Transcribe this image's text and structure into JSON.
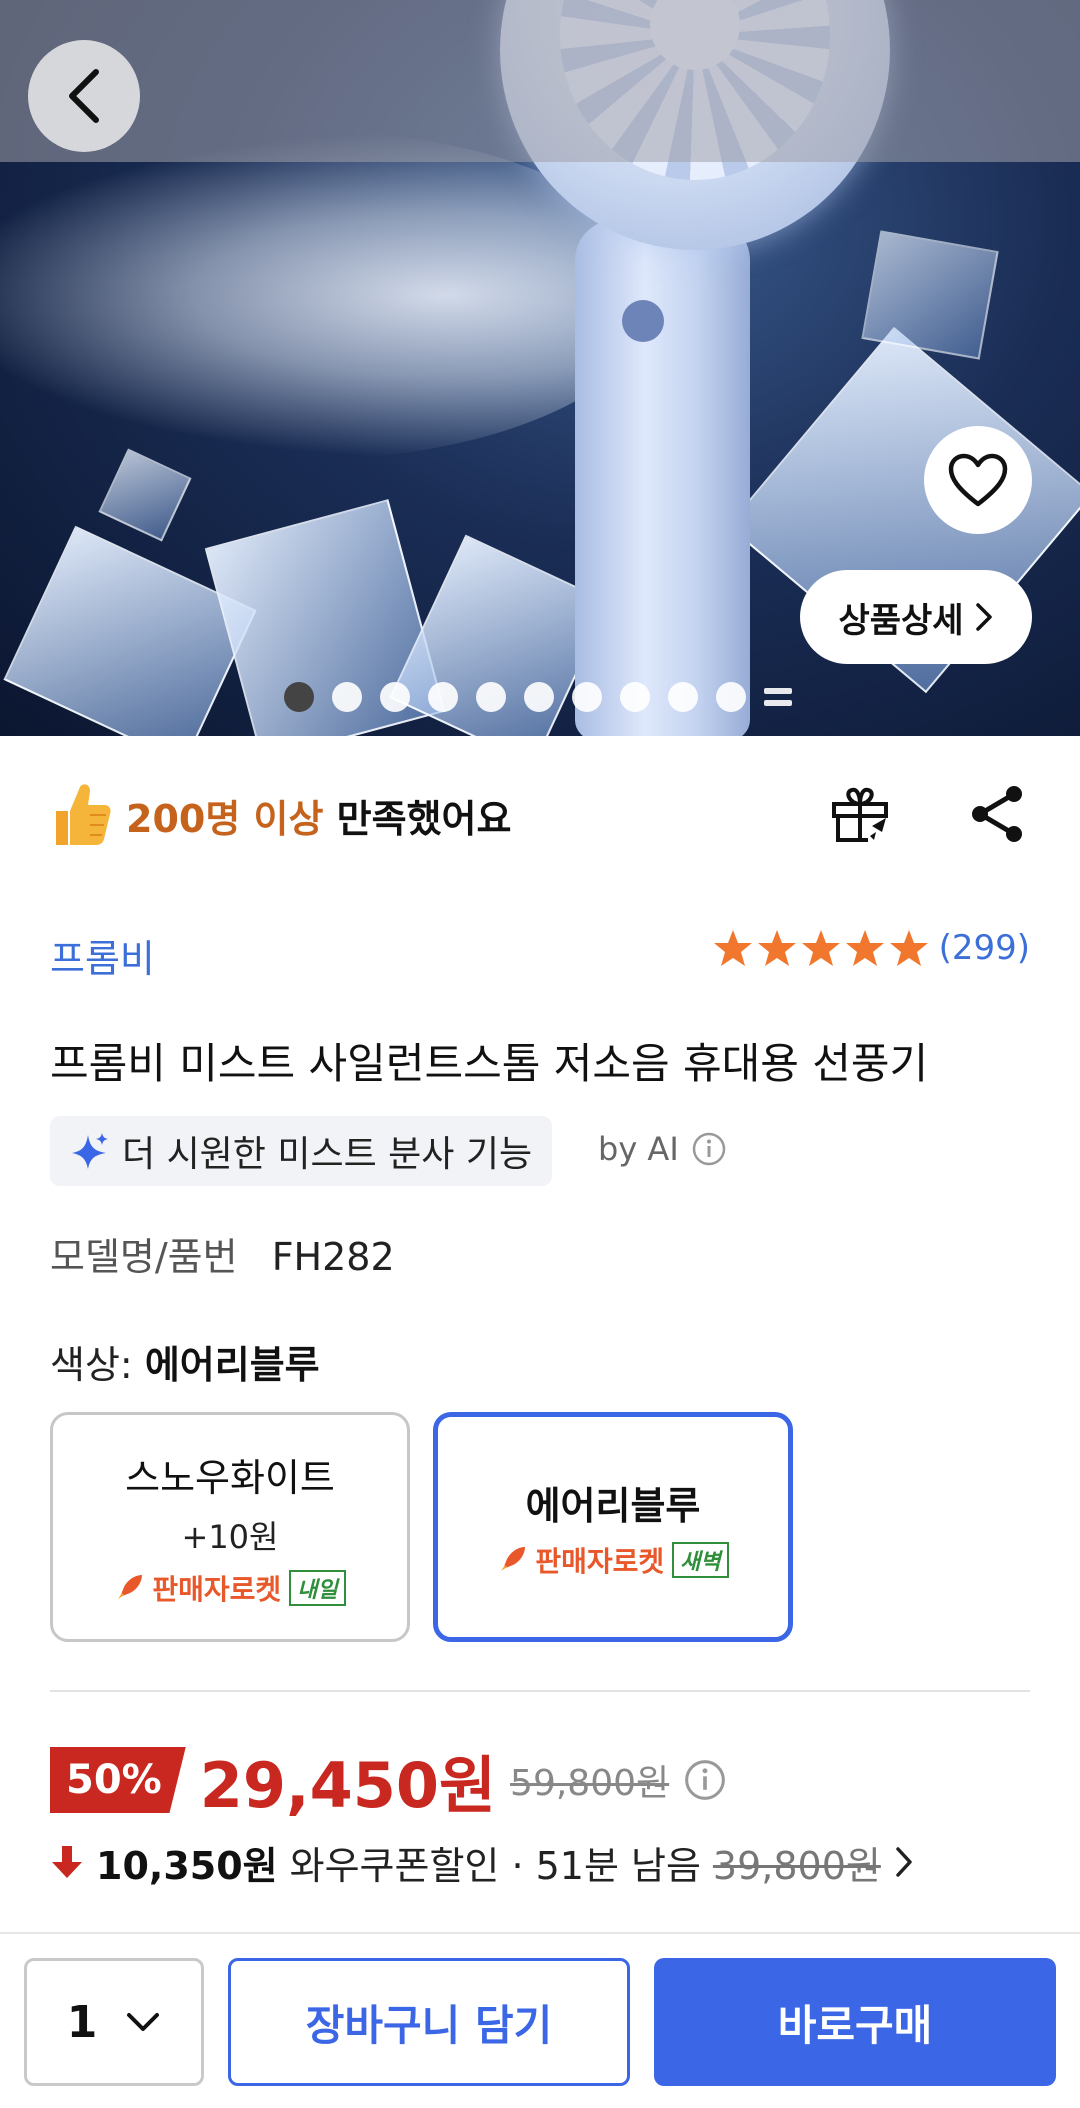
{
  "hero": {
    "detail_button_label": "상품상세",
    "image_count": 11,
    "active_index": 0
  },
  "satisfaction": {
    "highlight": "200명 이상",
    "suffix": " 만족했어요"
  },
  "product": {
    "brand": "프롬비",
    "rating_stars": 5,
    "rating_count": "(299)",
    "title": "프롬비 미스트 사일런트스톰 저소음 휴대용 선풍기",
    "ai_summary": "더 시원한 미스트 분사 기능",
    "ai_label": "by AI",
    "model_label": "모델명/품번",
    "model_value": "FH282"
  },
  "color": {
    "label": "색상: ",
    "selected": "에어리블루",
    "options": [
      {
        "name": "스노우화이트",
        "extra": "+10원",
        "badge": "판매자로켓",
        "tag": "내일",
        "selected": false
      },
      {
        "name": "에어리블루",
        "extra": "",
        "badge": "판매자로켓",
        "tag": "새벽",
        "selected": true
      }
    ]
  },
  "price": {
    "discount": "50%",
    "sale_price": "29,450원",
    "original_price": "59,800원",
    "coupon_amount": "10,350원",
    "coupon_text": "와우쿠폰할인 · 51분 남음",
    "coupon_original": "39,800원"
  },
  "bottom_bar": {
    "quantity": "1",
    "cart_label": "장바구니 담기",
    "buy_label": "바로구매"
  },
  "colors": {
    "accent_blue": "#3b66e6",
    "price_red": "#c8281f",
    "satisfaction_orange": "#c5621b",
    "star_orange": "#f2772e"
  }
}
